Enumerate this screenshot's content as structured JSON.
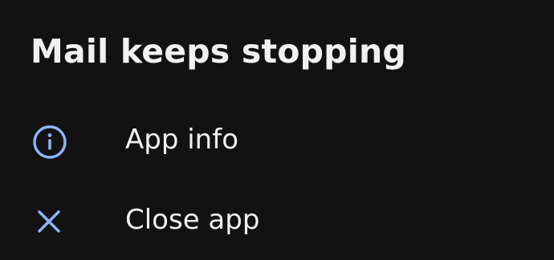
{
  "dialog": {
    "title": "Mail keeps stopping",
    "actions": [
      {
        "label": "App info",
        "icon": "info-icon"
      },
      {
        "label": "Close app",
        "icon": "close-icon"
      }
    ]
  },
  "colors": {
    "background": "#121212",
    "text": "#f1f1f1",
    "icon_accent": "#8ab4f8"
  }
}
